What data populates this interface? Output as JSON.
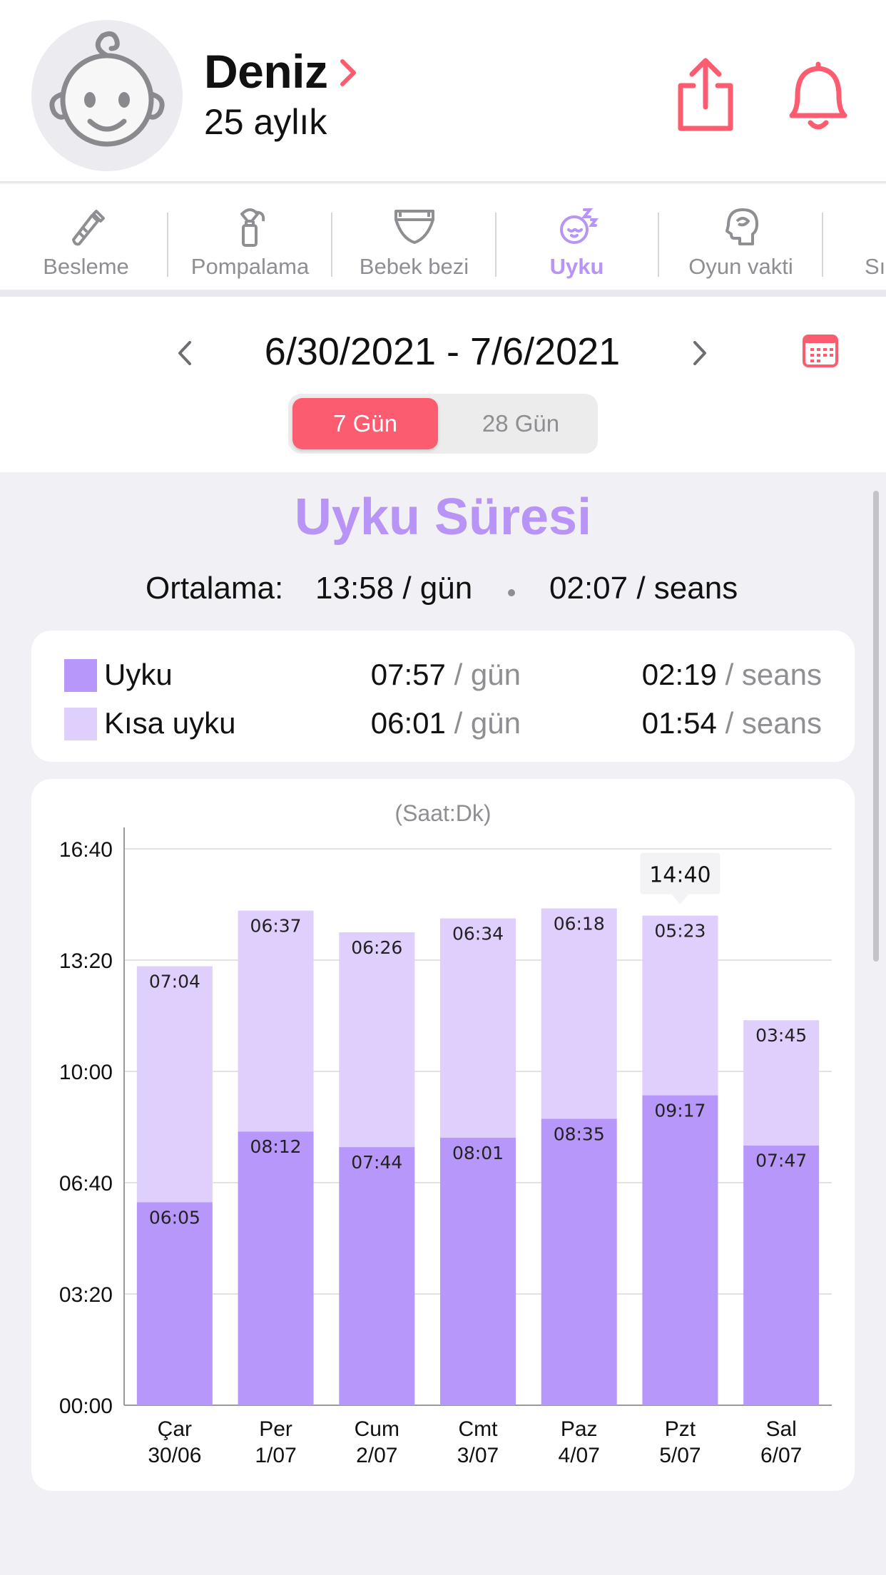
{
  "header": {
    "baby_name": "Deniz",
    "baby_age": "25 aylık",
    "accent_color": "#fb5c6f"
  },
  "tabs": [
    {
      "label": "Besleme",
      "icon": "bottle-icon",
      "active": false
    },
    {
      "label": "Pompalama",
      "icon": "breast-pump-icon",
      "active": false
    },
    {
      "label": "Bebek bezi",
      "icon": "diaper-icon",
      "active": false
    },
    {
      "label": "Uyku",
      "icon": "sleeping-baby-icon",
      "active": true
    },
    {
      "label": "Oyun vakti",
      "icon": "brain-head-icon",
      "active": false
    },
    {
      "label": "Sı",
      "icon": "",
      "active": false
    }
  ],
  "date_nav": {
    "range": "6/30/2021 - 7/6/2021",
    "segments": [
      "7 Gün",
      "28 Gün"
    ],
    "selected_segment": "7 Gün"
  },
  "averages": {
    "title": "Uyku Süresi",
    "label": "Ortalama:",
    "per_day": "13:58 / gün",
    "per_session": "02:07 / seans"
  },
  "summary": [
    {
      "name": "Uyku",
      "color": "#b797f9",
      "per_day_value": "07:57",
      "per_day_unit": "/ gün",
      "per_session_value": "02:19",
      "per_session_unit": "/ seans"
    },
    {
      "name": "Kısa uyku",
      "color": "#dfcffd",
      "per_day_value": "06:01",
      "per_day_unit": "/ gün",
      "per_session_value": "01:54",
      "per_session_unit": "/ seans"
    }
  ],
  "chart_data": {
    "type": "bar",
    "stacked": true,
    "unit_label": "(Saat:Dk)",
    "y_ticks": [
      "00:00",
      "03:20",
      "06:40",
      "10:00",
      "13:20",
      "16:40"
    ],
    "ylim_minutes": [
      0,
      1000
    ],
    "categories": [
      {
        "day": "Çar",
        "date": "30/06"
      },
      {
        "day": "Per",
        "date": "1/07"
      },
      {
        "day": "Cum",
        "date": "2/07"
      },
      {
        "day": "Cmt",
        "date": "3/07"
      },
      {
        "day": "Paz",
        "date": "4/07"
      },
      {
        "day": "Pzt",
        "date": "5/07"
      },
      {
        "day": "Sal",
        "date": "6/07"
      }
    ],
    "series": [
      {
        "name": "Uyku",
        "color": "#b797f9",
        "values": [
          "06:05",
          "08:12",
          "07:44",
          "08:01",
          "08:35",
          "09:17",
          "07:47"
        ]
      },
      {
        "name": "Kısa uyku",
        "color": "#dfcffd",
        "values": [
          "07:04",
          "06:37",
          "06:26",
          "06:34",
          "06:18",
          "05:23",
          "03:45"
        ]
      }
    ],
    "highlight": {
      "index": 5,
      "total": "14:40"
    },
    "grid": true
  }
}
